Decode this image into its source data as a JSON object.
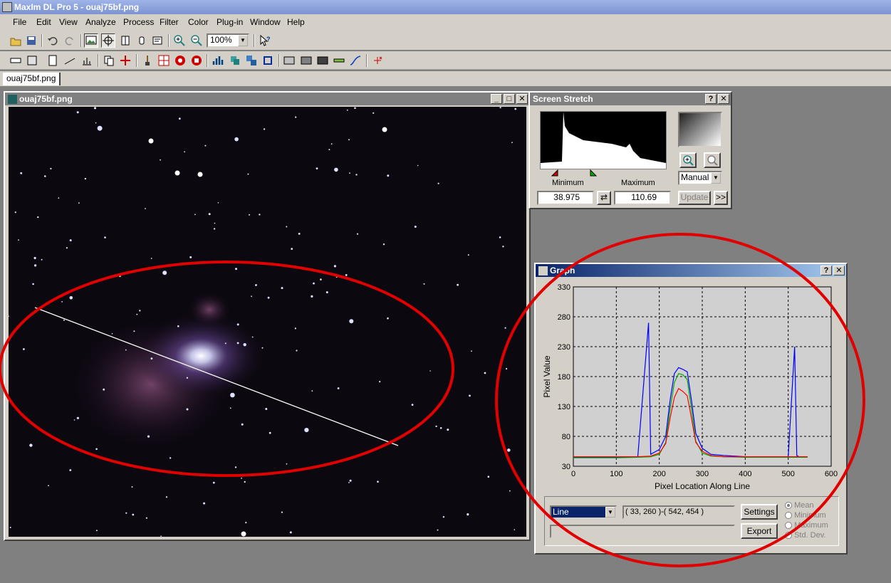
{
  "app": {
    "title": "MaxIm DL Pro 5 - ouaj75bf.png"
  },
  "menu": [
    "File",
    "Edit",
    "View",
    "Analyze",
    "Process",
    "Filter",
    "Color",
    "Plug-in",
    "Window",
    "Help"
  ],
  "toolbar": {
    "zoom_value": "100%"
  },
  "doc_tab": {
    "label": "ouaj75bf.png"
  },
  "image_window": {
    "title": "ouaj75bf.png"
  },
  "screen_stretch": {
    "title": "Screen Stretch",
    "minimum_label": "Minimum",
    "maximum_label": "Maximum",
    "minimum_value": "38.975",
    "maximum_value": "110.69",
    "mode": "Manual",
    "update_label": "Update",
    "more_label": ">>"
  },
  "graph": {
    "title": "Graph",
    "line_mode": "Line",
    "coords": "( 33, 260 )-( 542, 454 )",
    "settings_label": "Settings",
    "export_label": "Export",
    "options": [
      "Mean",
      "Minimum",
      "Maximum",
      "Std. Dev."
    ],
    "selected_option": "Mean"
  },
  "chart_data": {
    "type": "line",
    "xlabel": "Pixel Location Along Line",
    "ylabel": "Pixel Value",
    "xlim": [
      0,
      600
    ],
    "ylim": [
      30,
      330
    ],
    "xticks": [
      "0",
      "100",
      "200",
      "300",
      "400",
      "500",
      "600"
    ],
    "yticks": [
      "30",
      "80",
      "130",
      "180",
      "230",
      "280",
      "330"
    ],
    "grid": true,
    "series": [
      {
        "color": "#0000ff",
        "x": [
          0,
          100,
          150,
          175,
          180,
          185,
          200,
          215,
          225,
          235,
          245,
          255,
          265,
          275,
          285,
          300,
          320,
          350,
          400,
          450,
          500,
          515,
          520,
          525,
          545
        ],
        "y": [
          45,
          45,
          46,
          270,
          50,
          52,
          58,
          80,
          140,
          185,
          195,
          192,
          188,
          140,
          85,
          60,
          50,
          48,
          46,
          46,
          46,
          230,
          48,
          46,
          46
        ]
      },
      {
        "color": "#00aa00",
        "x": [
          0,
          100,
          150,
          180,
          200,
          215,
          225,
          235,
          245,
          255,
          265,
          275,
          285,
          300,
          320,
          350,
          400,
          450,
          500,
          545
        ],
        "y": [
          44,
          44,
          45,
          46,
          50,
          70,
          125,
          170,
          185,
          183,
          175,
          125,
          72,
          52,
          47,
          46,
          45,
          45,
          45,
          45
        ]
      },
      {
        "color": "#ff0000",
        "x": [
          0,
          100,
          150,
          180,
          200,
          215,
          225,
          235,
          245,
          255,
          265,
          275,
          285,
          300,
          320,
          350,
          400,
          450,
          500,
          545
        ],
        "y": [
          46,
          46,
          46,
          47,
          52,
          68,
          110,
          145,
          160,
          155,
          148,
          110,
          70,
          55,
          48,
          46,
          46,
          46,
          46,
          46
        ]
      }
    ]
  },
  "colors": {
    "annotation": "#e00000",
    "title_active": "#0a246a"
  }
}
